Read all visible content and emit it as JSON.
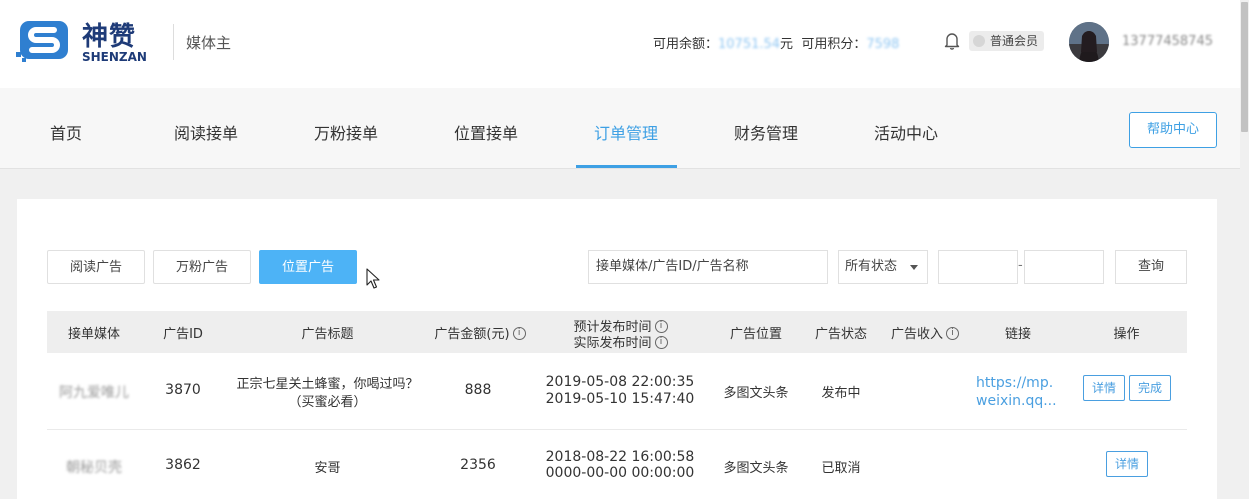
{
  "header": {
    "logo_cn": "神赞",
    "logo_en": "SHENZAN",
    "role": "媒体主",
    "balance_label": "可用余额：",
    "balance_value": "10751.54",
    "balance_unit": "元",
    "points_label": "可用积分：",
    "points_value": "7598",
    "member_label": "普通会员",
    "phone": "13777458745"
  },
  "nav": {
    "items": [
      "首页",
      "阅读接单",
      "万粉接单",
      "位置接单",
      "订单管理",
      "财务管理",
      "活动中心"
    ],
    "active": "订单管理",
    "help_label": "帮助中心"
  },
  "filters": {
    "tabs": [
      "阅读广告",
      "万粉广告",
      "位置广告"
    ],
    "active_tab": "位置广告",
    "search_placeholder": "接单媒体/广告ID/广告名称",
    "status_value": "所有状态",
    "date_separator": "-",
    "query_label": "查询"
  },
  "table": {
    "headers": {
      "media": "接单媒体",
      "id": "广告ID",
      "title": "广告标题",
      "amount": "广告金额(元)",
      "time_plan": "预计发布时间",
      "time_actual": "实际发布时间",
      "position": "广告位置",
      "status": "广告状态",
      "income": "广告收入",
      "link": "链接",
      "ops": "操作"
    },
    "rows": [
      {
        "media": "阿九爱唯儿",
        "id": "3870",
        "title_line1": "正宗七星关土蜂蜜，你喝过吗？",
        "title_line2": "（买蜜必看）",
        "amount": "888",
        "time_plan": "2019-05-08 22:00:35",
        "time_actual": "2019-05-10 15:47:40",
        "position": "多图文头条",
        "status": "发布中",
        "income": "",
        "link_line1": "https://mp.",
        "link_line2": "weixin.qq...",
        "ops": [
          "详情",
          "完成"
        ]
      },
      {
        "media": "朝秘贝壳",
        "id": "3862",
        "title_line1": "安哥",
        "title_line2": "",
        "amount": "2356",
        "time_plan": "2018-08-22 16:00:58",
        "time_actual": "0000-00-00 00:00:00",
        "position": "多图文头条",
        "status": "已取消",
        "income": "",
        "link_line1": "",
        "link_line2": "",
        "ops": [
          "详情"
        ]
      }
    ]
  },
  "colors": {
    "accent": "#3ea0e4",
    "active_tab_bg": "#4db3f6",
    "brand": "#1e3b78"
  }
}
